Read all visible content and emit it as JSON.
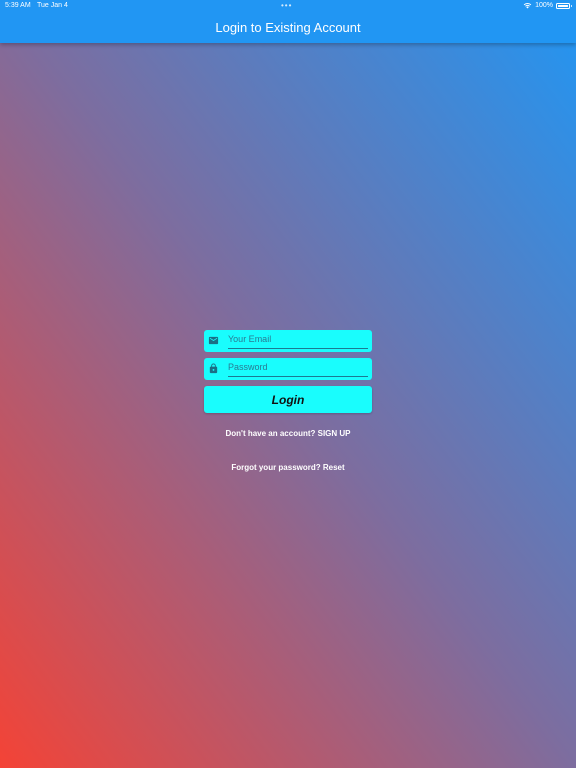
{
  "status_bar": {
    "time": "5:39 AM",
    "date": "Tue Jan 4",
    "battery": "100%"
  },
  "app_bar": {
    "title": "Login to Existing Account"
  },
  "form": {
    "email_placeholder": "Your Email",
    "password_placeholder": "Password",
    "email_icon": "mail-icon",
    "password_icon": "lock-icon",
    "login_label": "Login",
    "signup_text": "Don't have an account? SIGN UP",
    "reset_text": "Forgot your password? Reset"
  },
  "colors": {
    "app_bar": "#2196f3",
    "field_bg": "#19fdfd",
    "gradient_start": "#f44336",
    "gradient_end": "#2196f3"
  }
}
